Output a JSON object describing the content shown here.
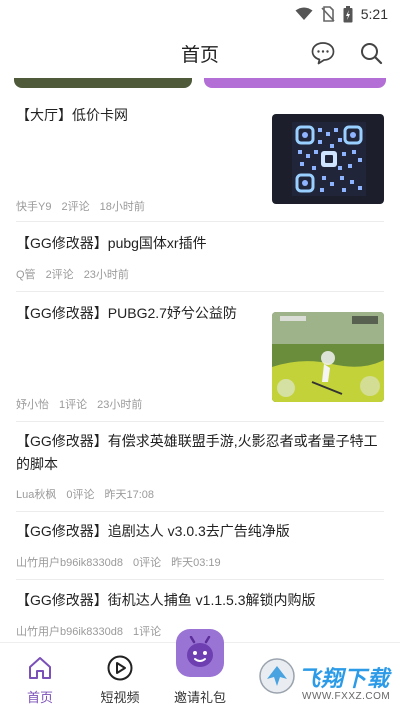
{
  "status_bar": {
    "time": "5:21",
    "icons": [
      "wifi-icon",
      "no-sim-icon",
      "battery-charging-icon"
    ]
  },
  "header": {
    "title": "首页",
    "icons": [
      "chat-icon",
      "search-icon"
    ]
  },
  "colors": {
    "accent": "#7b50b8",
    "strip_left": "#4e5a3a",
    "strip_right": "#b36fd6",
    "meta_text": "#9a9a9a"
  },
  "posts": [
    {
      "title": "【大厅】低价卡网",
      "author": "快手Y9",
      "comments": "2评论",
      "time": "18小时前",
      "thumb": "qr-code-image"
    },
    {
      "title": "【GG修改器】pubg国体xr插件",
      "author": "Q管",
      "comments": "2评论",
      "time": "23小时前"
    },
    {
      "title": "【GG修改器】PUBG2.7妤兮公益防",
      "author": "妤小怡",
      "comments": "1评论",
      "time": "23小时前",
      "thumb": "game-screenshot-image"
    },
    {
      "title": "【GG修改器】有偿求英雄联盟手游,火影忍者或者量子特工的脚本",
      "author": "Lua秋枫",
      "comments": "0评论",
      "time": "昨天17:08"
    },
    {
      "title": "【GG修改器】追剧达人 v3.0.3去广告纯净版",
      "author": "山竹用户b96ik8330d8",
      "comments": "0评论",
      "time": "昨天03:19"
    },
    {
      "title": "【GG修改器】街机达人捕鱼 v1.1.5.3解锁内购版",
      "author": "山竹用户b96ik8330d8",
      "comments": "1评论",
      "time": ""
    }
  ],
  "tabbar": {
    "tabs": [
      {
        "label": "首页",
        "icon": "home-icon",
        "active": true
      },
      {
        "label": "短视频",
        "icon": "play-circle-icon"
      },
      {
        "label": "邀请礼包",
        "icon": "gift-mascot-icon"
      }
    ]
  },
  "watermark": {
    "text": "飞翔下载",
    "url": "WWW.FXXZ.COM"
  }
}
